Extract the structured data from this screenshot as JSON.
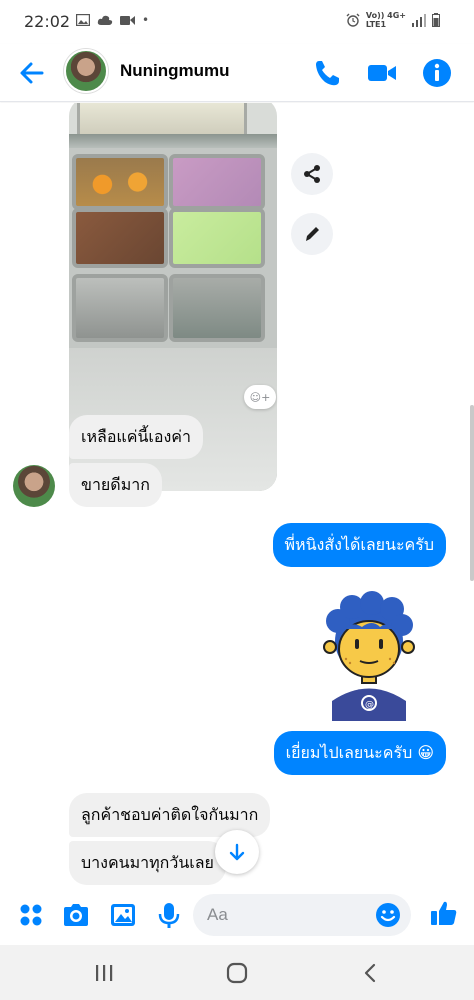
{
  "status_bar": {
    "time": "22:02",
    "network_top": "Vo)) 4G+",
    "network_bottom": "LTE1"
  },
  "header": {
    "contact_name": "Nuningmumu",
    "icons": [
      "back-arrow-icon",
      "phone-icon",
      "video-camera-icon",
      "info-icon"
    ],
    "accent_color": "#0084ff"
  },
  "chat": {
    "photo_actions": [
      "share-icon",
      "edit-pencil-icon"
    ],
    "reaction_button": "☺+",
    "messages": [
      {
        "direction": "incoming",
        "text": "เหลือแค่นี้เองค่า"
      },
      {
        "direction": "incoming",
        "text": "ขายดีมาก"
      },
      {
        "direction": "outgoing",
        "text": "พี่หนิงสั่งได้เลยนะครับ"
      },
      {
        "direction": "outgoing",
        "text": "เยี่ยมไปเลยนะครับ 😀"
      },
      {
        "direction": "incoming",
        "text": "ลูกค้าชอบค่าติดใจกันมาก"
      },
      {
        "direction": "incoming",
        "text": "บางคนมาทุกวันเลย"
      }
    ]
  },
  "composer": {
    "placeholder": "Aa",
    "icons": [
      "apps-grid-icon",
      "camera-icon",
      "gallery-icon",
      "microphone-icon",
      "emoji-icon",
      "thumbs-up-icon"
    ]
  },
  "nav_bar": {
    "icons": [
      "recents-icon",
      "home-icon",
      "back-icon"
    ]
  }
}
